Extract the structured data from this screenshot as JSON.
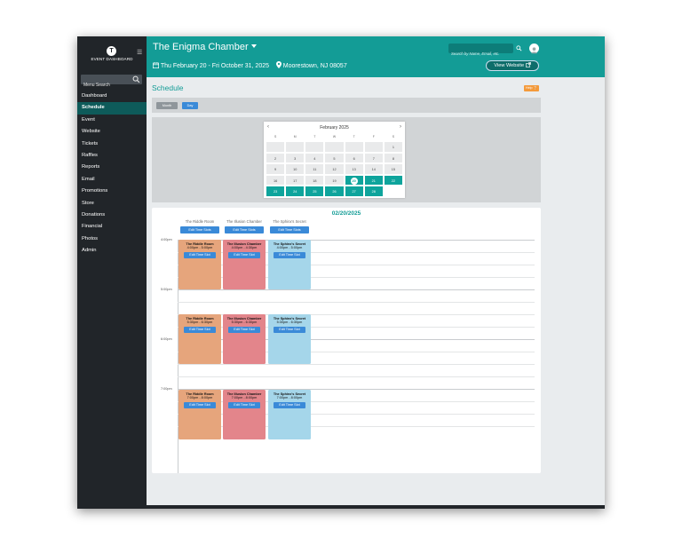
{
  "sidebar": {
    "logo_letter": "T",
    "logo_text": "EVENT DASHBOARD",
    "search_placeholder": "Menu Search",
    "items": [
      {
        "label": "Dashboard",
        "active": false
      },
      {
        "label": "Schedule",
        "active": true
      },
      {
        "label": "Event",
        "active": false
      },
      {
        "label": "Website",
        "active": false
      },
      {
        "label": "Tickets",
        "active": false
      },
      {
        "label": "Raffles",
        "active": false
      },
      {
        "label": "Reports",
        "active": false
      },
      {
        "label": "Email",
        "active": false
      },
      {
        "label": "Promotions",
        "active": false
      },
      {
        "label": "Store",
        "active": false
      },
      {
        "label": "Donations",
        "active": false
      },
      {
        "label": "Financial",
        "active": false
      },
      {
        "label": "Photos",
        "active": false
      },
      {
        "label": "Admin",
        "active": false
      }
    ]
  },
  "header": {
    "event_title": "The Enigma Chamber",
    "dates": "Thu February 20 - Fri October 31, 2025",
    "location": "Moorestown, NJ 08057",
    "search_placeholder": "Search by Name, Email, etc.",
    "view_website_label": "View Website",
    "accent_color": "#139c96"
  },
  "main": {
    "page_title": "Schedule",
    "help_label": "Help",
    "view_toggle": {
      "month": "Month",
      "day": "Day"
    }
  },
  "mini_calendar": {
    "month_label": "February 2025",
    "days_of_week": [
      "S",
      "M",
      "T",
      "W",
      "T",
      "F",
      "S"
    ],
    "weeks": [
      [
        "",
        "",
        "",
        "",
        "",
        "",
        "1"
      ],
      [
        "2",
        "3",
        "4",
        "5",
        "6",
        "7",
        "8"
      ],
      [
        "9",
        "10",
        "11",
        "12",
        "13",
        "14",
        "15"
      ],
      [
        "16",
        "17",
        "18",
        "19",
        "20",
        "21",
        "22"
      ],
      [
        "23",
        "24",
        "25",
        "26",
        "27",
        "28",
        ""
      ]
    ],
    "selected_day": "20"
  },
  "day_view": {
    "date": "02/20/2025",
    "rooms": [
      {
        "name": "The Riddle Room",
        "edit_label": "Edit Time Slots"
      },
      {
        "name": "The Illusion Chamber",
        "edit_label": "Edit Time Slots"
      },
      {
        "name": "The Sphinx's Secret",
        "edit_label": "Edit Time Slots"
      }
    ],
    "hours": [
      "4:00pm",
      "5:00pm",
      "6:00pm",
      "7:00pm"
    ],
    "events": [
      {
        "room": 0,
        "title": "The Riddle Room",
        "time": "4:00pm - 5:00pm",
        "slot": 0,
        "color": "orange"
      },
      {
        "room": 1,
        "title": "The Illusion Chamber",
        "time": "4:00pm - 4:30pm",
        "slot": 0,
        "color": "red"
      },
      {
        "room": 2,
        "title": "The Sphinx's Secret",
        "time": "4:00pm - 5:00pm",
        "slot": 0,
        "color": "blue"
      },
      {
        "room": 0,
        "title": "The Riddle Room",
        "time": "5:30pm - 6:30pm",
        "slot": 1,
        "color": "orange"
      },
      {
        "room": 1,
        "title": "The Illusion Chamber",
        "time": "5:30pm - 6:30pm",
        "slot": 1,
        "color": "red"
      },
      {
        "room": 2,
        "title": "The Sphinx's Secret",
        "time": "5:30pm - 6:30pm",
        "slot": 1,
        "color": "blue"
      },
      {
        "room": 0,
        "title": "The Riddle Room",
        "time": "7:00pm - 8:00pm",
        "slot": 2,
        "color": "orange"
      },
      {
        "room": 1,
        "title": "The Illusion Chamber",
        "time": "7:00pm - 8:00pm",
        "slot": 2,
        "color": "red"
      },
      {
        "room": 2,
        "title": "The Sphinx's Secret",
        "time": "7:00pm - 8:00pm",
        "slot": 2,
        "color": "blue"
      }
    ],
    "event_edit_label": "Edit Time Slot"
  }
}
